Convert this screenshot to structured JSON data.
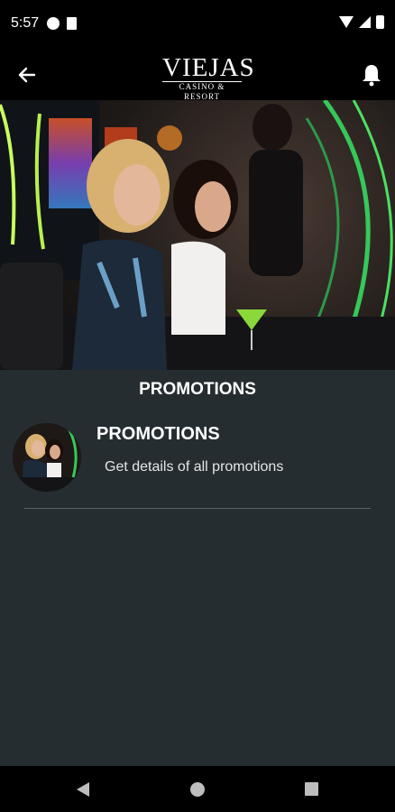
{
  "status_bar": {
    "time": "5:57"
  },
  "app_bar": {
    "logo_main": "VIEJAS",
    "logo_sub": "CASINO & RESORT"
  },
  "hero": {
    "image": "casino-guests-photo"
  },
  "section": {
    "title": "PROMOTIONS"
  },
  "list": {
    "items": [
      {
        "title": "PROMOTIONS",
        "subtitle": "Get details of all promotions",
        "thumbnail": "promotions-thumbnail"
      }
    ]
  },
  "colors": {
    "background": "#252d30",
    "bars": "#000000",
    "text": "#ffffff",
    "neon_accent": "#4be060"
  },
  "icons": [
    "back-arrow-icon",
    "bell-icon",
    "nav-back-icon",
    "nav-home-icon",
    "nav-recent-icon"
  ]
}
